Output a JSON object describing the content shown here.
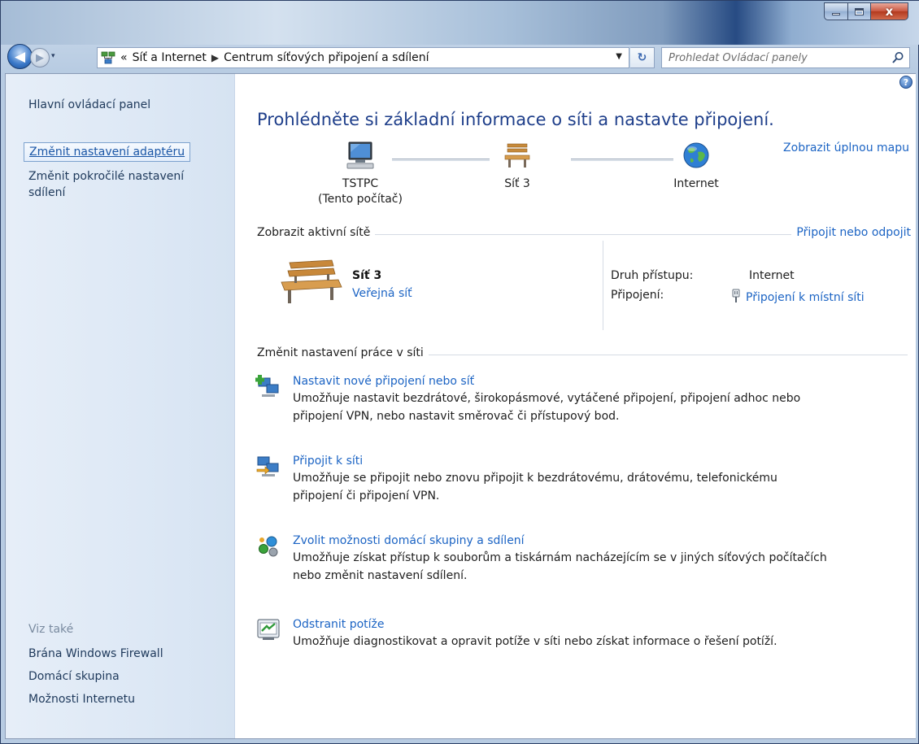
{
  "window": {
    "buttons": {
      "close_label": "x"
    }
  },
  "nav": {
    "back_glyph": "◀",
    "forward_glyph": "▶",
    "recent_glyph": "▾"
  },
  "address": {
    "overflow": "«",
    "crumbs": [
      "Síť a Internet",
      "Centrum síťových připojení a sdílení"
    ],
    "separator": "▶",
    "dropdown_glyph": "▼",
    "refresh_glyph": "↻"
  },
  "search": {
    "placeholder": "Prohledat Ovládací panely"
  },
  "sidebar": {
    "home": "Hlavní ovládací panel",
    "links": [
      "Změnit nastavení adaptéru",
      "Změnit pokročilé nastavení",
      "sdílení"
    ],
    "see_also_label": "Viz také",
    "see_also": [
      "Brána Windows Firewall",
      "Domácí skupina",
      "Možnosti Internetu"
    ]
  },
  "main": {
    "help_glyph": "?",
    "title": "Prohlédněte si základní informace o síti a nastavte připojení.",
    "full_map_link": "Zobrazit úplnou mapu",
    "map": {
      "computer_name": "TSTPC",
      "computer_sub": "(Tento počítač)",
      "network": "Síť 3",
      "internet": "Internet"
    },
    "active_networks": {
      "heading": "Zobrazit aktivní sítě",
      "connect_link": "Připojit nebo odpojit",
      "network_name": "Síť 3",
      "network_type": "Veřejná síť",
      "access_type_label": "Druh přístupu:",
      "access_type_value": "Internet",
      "connections_label": "Připojení:",
      "connections_value": "Připojení k místní síti"
    },
    "change_settings": {
      "heading": "Změnit nastavení práce v síti",
      "tasks": [
        {
          "title": "Nastavit nové připojení nebo síť",
          "desc1": "Umožňuje nastavit bezdrátové, širokopásmové, vytáčené připojení, připojení adhoc nebo",
          "desc2": "připojení VPN, nebo nastavit směrovač či přístupový bod."
        },
        {
          "title": "Připojit k síti",
          "desc1": "Umožňuje se připojit nebo znovu připojit k bezdrátovému, drátovému, telefonickému",
          "desc2": "připojení či připojení VPN."
        },
        {
          "title": "Zvolit možnosti domácí skupiny a sdílení",
          "desc1": "Umožňuje získat přístup k souborům a tiskárnám nacházejícím se v jiných síťových počítačích",
          "desc2": "nebo změnit nastavení sdílení."
        },
        {
          "title": "Odstranit potíže",
          "desc1": "Umožňuje diagnostikovat a opravit potíže v síti nebo získat informace o řešení potíží.",
          "desc2": ""
        }
      ]
    }
  },
  "colors": {
    "link": "#1c64c4",
    "title": "#1e3e8a",
    "sidebar_bg": "#dde8f5"
  }
}
